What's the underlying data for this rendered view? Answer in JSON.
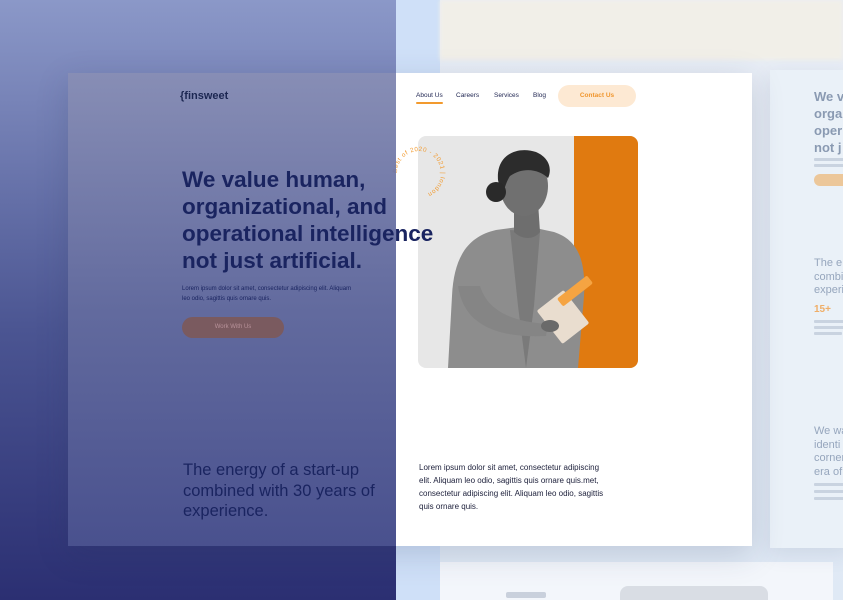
{
  "brand": {
    "logo": "{finsweet"
  },
  "nav": {
    "items": [
      "About Us",
      "Careers",
      "Services",
      "Blog"
    ],
    "active_index": 0,
    "contact_label": "Contact Us"
  },
  "hero": {
    "title_lines": [
      "We value human,",
      "organizational, and",
      "operational intelligence",
      "not just artificial."
    ],
    "desc_lines": [
      "Lorem ipsum dolor sit amet, consectetur adipiscing elit. Aliquam",
      "leo odio, sagittis quis ornare quis."
    ],
    "button_label": "Work With Us"
  },
  "badge": {
    "text": "Best of 2020 - 2021 | london"
  },
  "section2": {
    "title_lines": [
      "The energy of a start-up",
      "combined with 30 years of",
      "experience."
    ],
    "body_lines": [
      "Lorem ipsum dolor sit amet, consectetur adipiscing",
      "elit. Aliquam leo odio, sagittis quis ornare quis.met,",
      "consectetur adipiscing elit. Aliquam leo odio, sagittis",
      "quis ornare quis."
    ]
  },
  "peek": {
    "title_lines": [
      "We v",
      "orga",
      "oper",
      "not j"
    ],
    "h2_lines": [
      "The e",
      "combi",
      "experi"
    ],
    "number": "15+",
    "h3_lines": [
      "We wa",
      "identi",
      "corner",
      "era of"
    ]
  },
  "colors": {
    "accent": "#f29a2e",
    "photo_orange": "#e07a10",
    "navy": "#1a2460"
  }
}
